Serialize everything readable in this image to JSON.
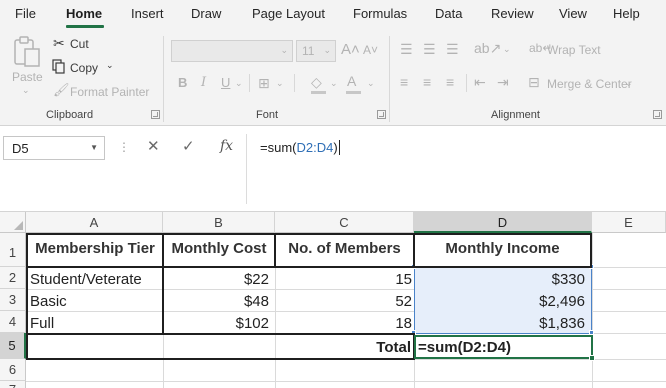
{
  "menu": {
    "tabs": [
      "File",
      "Home",
      "Insert",
      "Draw",
      "Page Layout",
      "Formulas",
      "Data",
      "Review",
      "View",
      "Help"
    ],
    "active": "Home"
  },
  "ribbon": {
    "clipboard": {
      "paste": "Paste",
      "cut": "Cut",
      "copy": "Copy",
      "format_painter": "Format Painter",
      "label": "Clipboard"
    },
    "font": {
      "font_name": "",
      "font_size": "11",
      "bold": "B",
      "italic": "I",
      "underline": "U",
      "label": "Font"
    },
    "alignment": {
      "wrap_text": "Wrap Text",
      "merge_center": "Merge & Center",
      "label": "Alignment"
    },
    "accent_color": "#217346"
  },
  "formula_bar": {
    "name_box": "D5",
    "fx": "fx",
    "formula_prefix": "=sum(",
    "formula_ref": "D2:D4",
    "formula_suffix": ")"
  },
  "sheet": {
    "columns": [
      "A",
      "B",
      "C",
      "D",
      "E"
    ],
    "rows": [
      "1",
      "2",
      "3",
      "4",
      "5",
      "6",
      "7"
    ],
    "headers": {
      "tier": "Membership Tier",
      "cost": "Monthly Cost",
      "members": "No. of Members",
      "income": "Monthly Income"
    },
    "data": [
      {
        "tier": "Student/Veterate",
        "cost": "$22",
        "members": "15",
        "income": "$330"
      },
      {
        "tier": "Basic",
        "cost": "$48",
        "members": "52",
        "income": "$2,496"
      },
      {
        "tier": "Full",
        "cost": "$102",
        "members": "18",
        "income": "$1,836"
      }
    ],
    "total_label": "Total",
    "total_formula": "=sum(D2:D4)",
    "selection_fill": "#e6eefa",
    "selection_border": "#4a83c9"
  }
}
